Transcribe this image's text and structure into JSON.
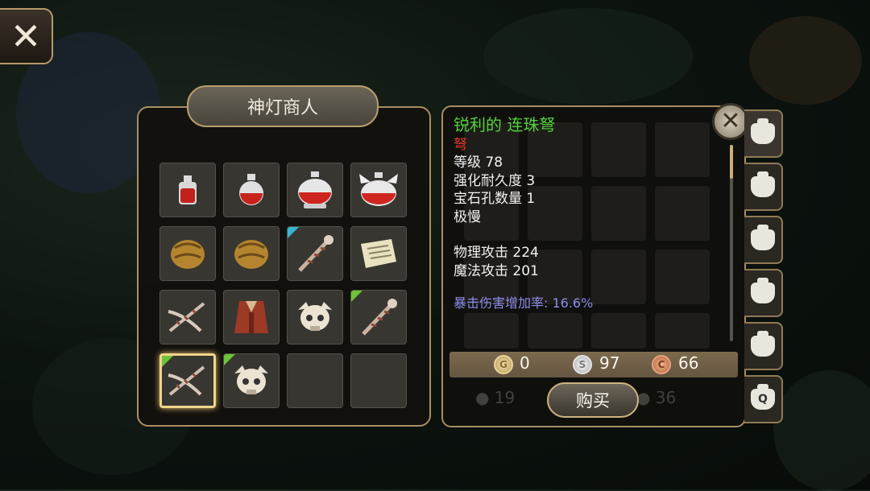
{
  "shop": {
    "title": "神灯商人"
  },
  "slots": [
    {
      "icon": "small-red-potion-icon"
    },
    {
      "icon": "red-potion-icon"
    },
    {
      "icon": "large-red-potion-icon"
    },
    {
      "icon": "winged-red-potion-icon"
    },
    {
      "icon": "leather-gloves-icon"
    },
    {
      "icon": "leather-gloves-icon"
    },
    {
      "icon": "bone-staff-icon",
      "corner": "cyan"
    },
    {
      "icon": "scroll-icon"
    },
    {
      "icon": "bone-crossbow-icon"
    },
    {
      "icon": "red-robe-icon"
    },
    {
      "icon": "skull-helmet-icon"
    },
    {
      "icon": "bone-staff-icon",
      "corner": "green"
    },
    {
      "icon": "bone-crossbow-icon",
      "corner": "green",
      "selected": true
    },
    {
      "icon": "skull-helmet-icon",
      "corner": "green"
    },
    {
      "icon": "empty"
    },
    {
      "icon": "empty"
    }
  ],
  "detail": {
    "name": "锐利的 连珠弩",
    "type": "弩",
    "level": "等级 78",
    "durability": "强化耐久度 3",
    "gem_slots": "宝石孔数量 1",
    "speed": "极慢",
    "physical_attack": "物理攻击 224",
    "magic_attack": "魔法攻击 201",
    "crit_bonus": "暴击伤害增加率: 16.6%"
  },
  "price": {
    "gold": "0",
    "silver": "97",
    "copper": "66"
  },
  "buy_label": "购买",
  "colors": {
    "name": "#52d13c",
    "type": "#e43b2e",
    "crit": "#8d8eea",
    "frame": "#a88e62"
  }
}
